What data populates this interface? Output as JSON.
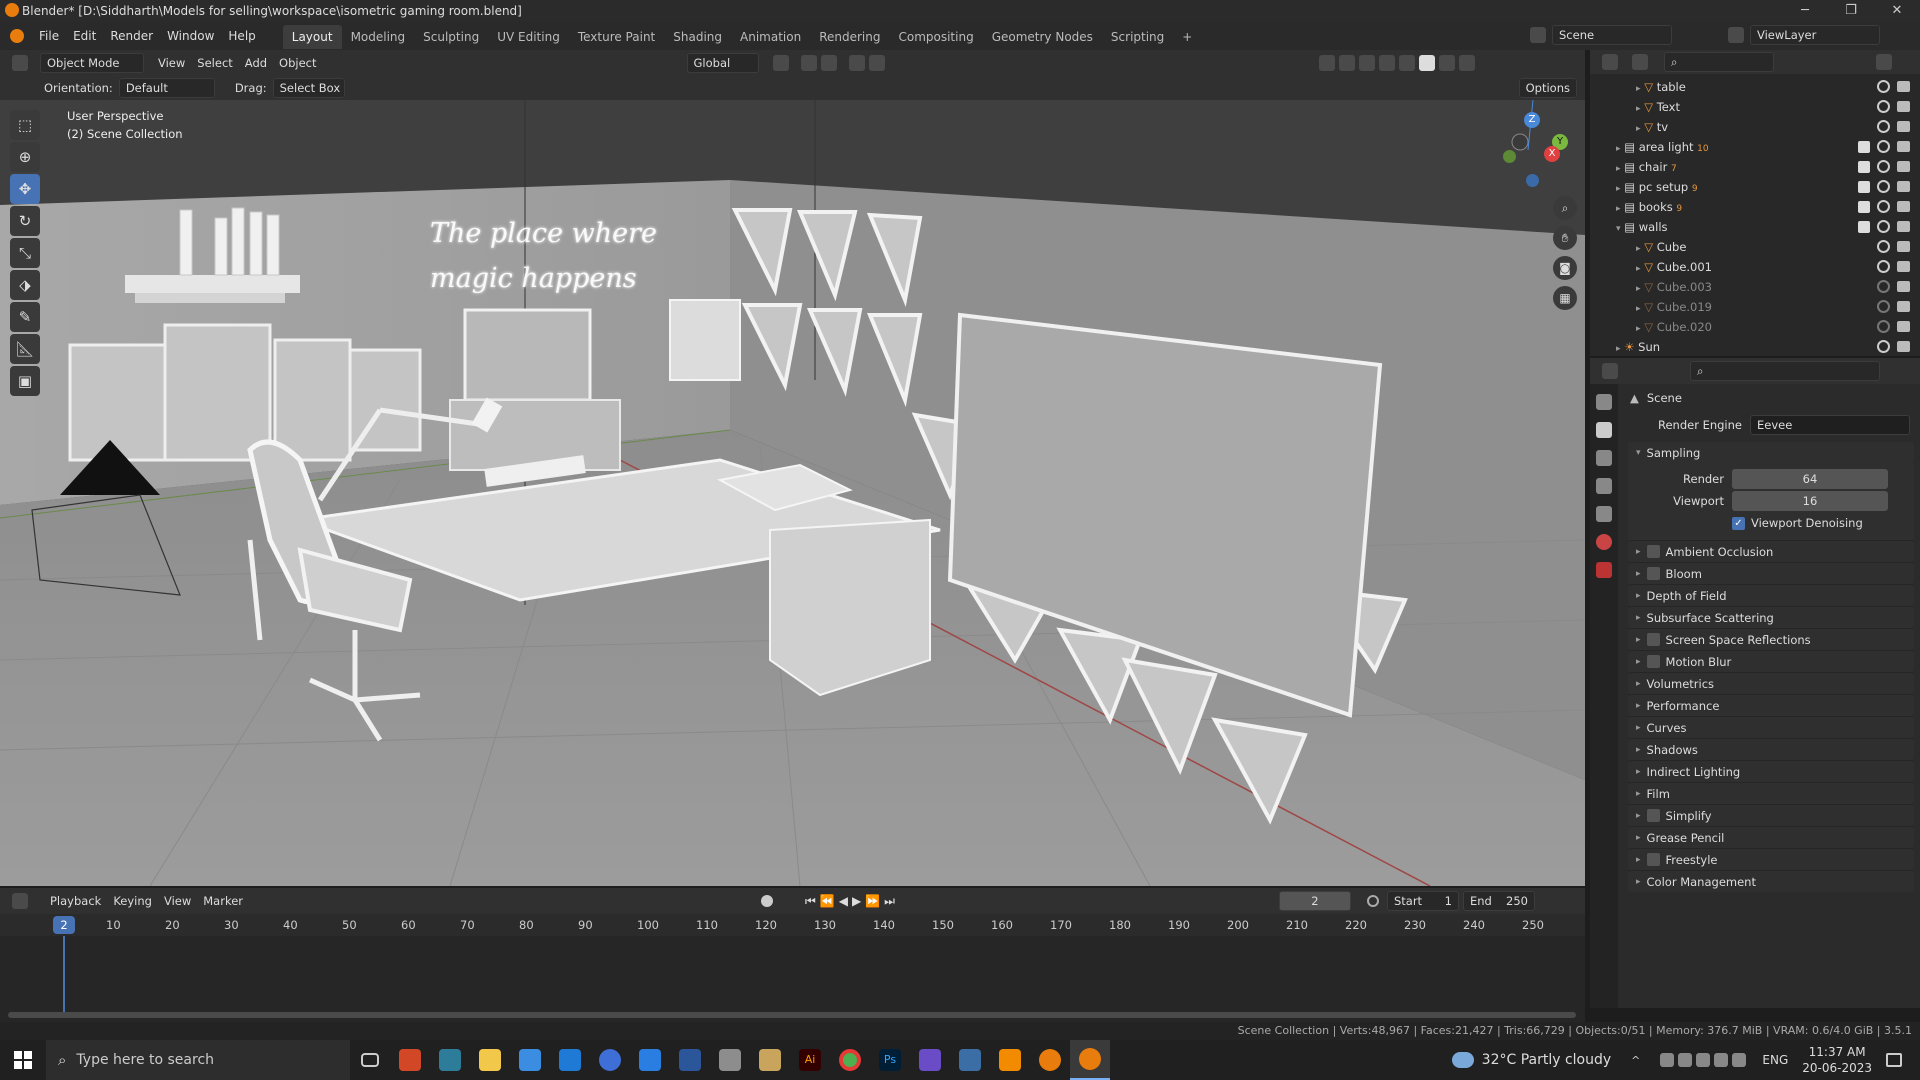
{
  "window": {
    "title": "Blender* [D:\\Siddharth\\Models for selling\\workspace\\isometric gaming room.blend]"
  },
  "menu": {
    "items": [
      "File",
      "Edit",
      "Render",
      "Window",
      "Help"
    ]
  },
  "workspaces": {
    "tabs": [
      "Layout",
      "Modeling",
      "Sculpting",
      "UV Editing",
      "Texture Paint",
      "Shading",
      "Animation",
      "Rendering",
      "Compositing",
      "Geometry Nodes",
      "Scripting"
    ],
    "active": "Layout",
    "add": "+"
  },
  "scene_selector": {
    "scene": "Scene",
    "view_layer": "ViewLayer"
  },
  "viewport_header": {
    "mode": "Object Mode",
    "menus": [
      "View",
      "Select",
      "Add",
      "Object"
    ],
    "transform": "Global",
    "options": "Options"
  },
  "tool_settings": {
    "orientation_label": "Orientation:",
    "orientation_value": "Default",
    "drag_label": "Drag:",
    "drag_value": "Select Box"
  },
  "viewport": {
    "perspective": "User Perspective",
    "collection": "(2) Scene Collection",
    "neon_line1": "The place where",
    "neon_line2": "magic happens",
    "gizmo": {
      "z": "Z",
      "y": "Y",
      "x": "X"
    }
  },
  "outliner": {
    "rows": [
      {
        "label": "table",
        "level": 1,
        "dim": false
      },
      {
        "label": "Text",
        "level": 1,
        "dim": false
      },
      {
        "label": "tv",
        "level": 1,
        "dim": false
      },
      {
        "label": "area light",
        "level": 0,
        "dim": false,
        "badge": "10"
      },
      {
        "label": "chair",
        "level": 0,
        "dim": false,
        "badge": "7"
      },
      {
        "label": "pc setup",
        "level": 0,
        "dim": false,
        "badge": "9"
      },
      {
        "label": "books",
        "level": 0,
        "dim": false,
        "badge": "9"
      },
      {
        "label": "walls",
        "level": 0,
        "dim": false
      },
      {
        "label": "Cube",
        "level": 1,
        "dim": false
      },
      {
        "label": "Cube.001",
        "level": 1,
        "dim": false
      },
      {
        "label": "Cube.003",
        "level": 1,
        "dim": true
      },
      {
        "label": "Cube.019",
        "level": 1,
        "dim": true
      },
      {
        "label": "Cube.020",
        "level": 1,
        "dim": true
      },
      {
        "label": "Sun",
        "level": 0,
        "dim": false
      }
    ]
  },
  "properties": {
    "context": "Scene",
    "render_engine_label": "Render Engine",
    "render_engine_value": "Eevee",
    "sampling": {
      "header": "Sampling",
      "render_label": "Render",
      "render_value": "64",
      "viewport_label": "Viewport",
      "viewport_value": "16",
      "denoise_label": "Viewport Denoising"
    },
    "panels": [
      {
        "label": "Ambient Occlusion",
        "checkbox": true
      },
      {
        "label": "Bloom",
        "checkbox": true
      },
      {
        "label": "Depth of Field",
        "checkbox": false
      },
      {
        "label": "Subsurface Scattering",
        "checkbox": false
      },
      {
        "label": "Screen Space Reflections",
        "checkbox": true
      },
      {
        "label": "Motion Blur",
        "checkbox": true
      },
      {
        "label": "Volumetrics",
        "checkbox": false
      },
      {
        "label": "Performance",
        "checkbox": false
      },
      {
        "label": "Curves",
        "checkbox": false
      },
      {
        "label": "Shadows",
        "checkbox": false
      },
      {
        "label": "Indirect Lighting",
        "checkbox": false
      },
      {
        "label": "Film",
        "checkbox": false
      },
      {
        "label": "Simplify",
        "checkbox": true
      },
      {
        "label": "Grease Pencil",
        "checkbox": false
      },
      {
        "label": "Freestyle",
        "checkbox": true
      },
      {
        "label": "Color Management",
        "checkbox": false
      }
    ]
  },
  "timeline": {
    "menus": [
      "Playback",
      "Keying",
      "View",
      "Marker"
    ],
    "current_frame": "2",
    "start_label": "Start",
    "start_value": "1",
    "end_label": "End",
    "end_value": "250",
    "ticks": [
      "10",
      "20",
      "30",
      "40",
      "50",
      "60",
      "70",
      "80",
      "90",
      "100",
      "110",
      "120",
      "130",
      "140",
      "150",
      "160",
      "170",
      "180",
      "190",
      "200",
      "210",
      "220",
      "230",
      "240",
      "250"
    ]
  },
  "statusbar": {
    "text": "Scene Collection | Verts:48,967 | Faces:21,427 | Tris:66,729 | Objects:0/51 | Memory: 376.7 MiB | VRAM: 0.6/4.0 GiB | 3.5.1"
  },
  "taskbar": {
    "search_placeholder": "Type here to search",
    "weather": "32°C  Partly cloudy",
    "lang": "ENG",
    "time": "11:37 AM",
    "date": "20-06-2023",
    "colors": {
      "blender": "#e87d0d",
      "accent": "#4772b3",
      "photoshop": "#31a8ff",
      "chrome": "#4caf50"
    }
  }
}
